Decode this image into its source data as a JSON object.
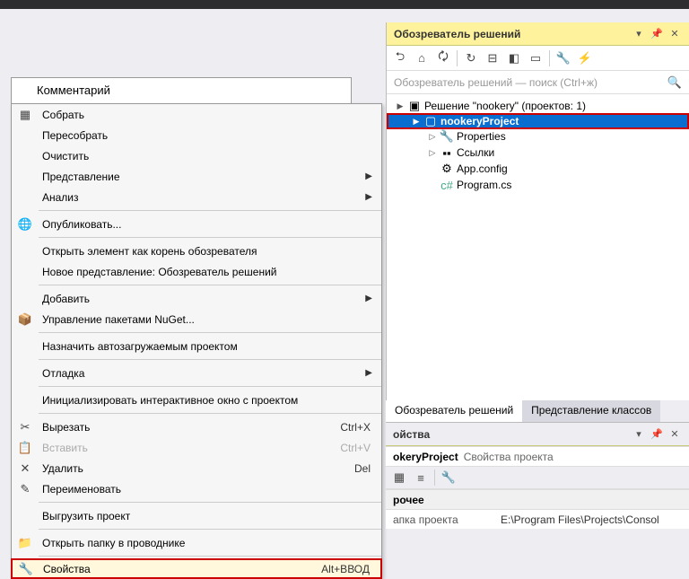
{
  "comments": {
    "header": "Комментарий"
  },
  "contextMenu": {
    "items": [
      {
        "label": "Собрать",
        "icon": "build"
      },
      {
        "label": "Пересобрать"
      },
      {
        "label": "Очистить"
      },
      {
        "label": "Представление",
        "submenu": true
      },
      {
        "label": "Анализ",
        "submenu": true
      },
      {
        "sep": true
      },
      {
        "label": "Опубликовать...",
        "icon": "globe"
      },
      {
        "sep": true
      },
      {
        "label": "Открыть элемент как корень обозревателя"
      },
      {
        "label": "Новое представление: Обозреватель решений"
      },
      {
        "sep": true
      },
      {
        "label": "Добавить",
        "submenu": true
      },
      {
        "label": "Управление пакетами NuGet...",
        "icon": "nuget"
      },
      {
        "sep": true
      },
      {
        "label": "Назначить автозагружаемым проектом"
      },
      {
        "sep": true
      },
      {
        "label": "Отладка",
        "submenu": true
      },
      {
        "sep": true
      },
      {
        "label": "Инициализировать интерактивное окно с проектом"
      },
      {
        "sep": true
      },
      {
        "label": "Вырезать",
        "icon": "cut",
        "shortcut": "Ctrl+X"
      },
      {
        "label": "Вставить",
        "icon": "paste",
        "shortcut": "Ctrl+V",
        "disabled": true
      },
      {
        "label": "Удалить",
        "icon": "delete",
        "shortcut": "Del"
      },
      {
        "label": "Переименовать",
        "icon": "rename"
      },
      {
        "sep": true
      },
      {
        "label": "Выгрузить проект"
      },
      {
        "sep": true
      },
      {
        "label": "Открыть папку в проводнике",
        "icon": "folder"
      },
      {
        "sep": true
      },
      {
        "label": "Свойства",
        "icon": "wrench",
        "shortcut": "Alt+ВВОД",
        "highlighted": true
      }
    ]
  },
  "solutionExplorer": {
    "title": "Обозреватель решений",
    "searchPlaceholder": "Обозреватель решений — поиск (Ctrl+ж)",
    "solution": "Решение \"nookery\"  (проектов: 1)",
    "project": "nookeryProject",
    "nodes": {
      "properties": "Properties",
      "refs": "Ссылки",
      "appconfig": "App.config",
      "program": "Program.cs"
    }
  },
  "tabs": {
    "solution": "Обозреватель решений",
    "classes": "Представление классов"
  },
  "props": {
    "title": "ойства",
    "objName": "okeryProject",
    "objType": "Свойства проекта",
    "category": "рочее",
    "folderLabel": "апка проекта",
    "folderValue": "E:\\Program Files\\Projects\\Consol"
  }
}
